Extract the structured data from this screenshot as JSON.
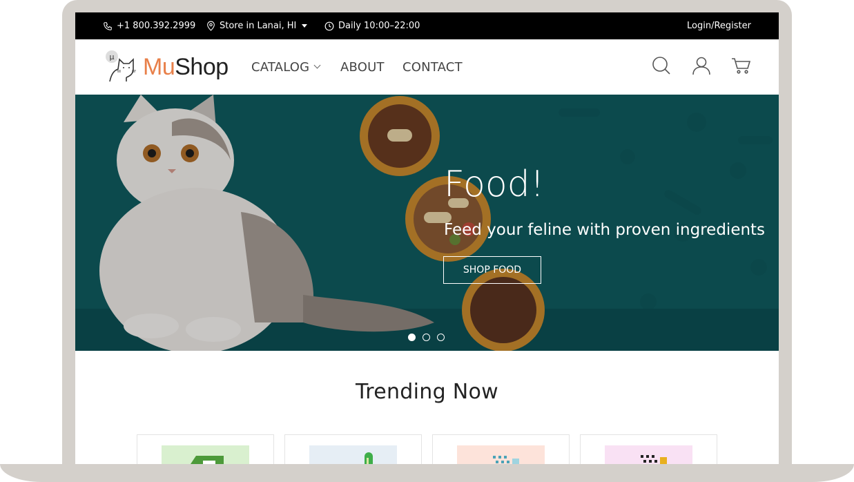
{
  "topbar": {
    "phone": "+1 800.392.2999",
    "store": "Store in Lanai, HI",
    "hours": "Daily 10:00–22:00",
    "login": "Login/Register"
  },
  "nav": {
    "logo_mu": "Mu",
    "logo_shop": "Shop",
    "logo_badge": "µ",
    "menu": [
      {
        "label": "CATALOG"
      },
      {
        "label": "ABOUT"
      },
      {
        "label": "CONTACT"
      }
    ],
    "icons": [
      "search-icon",
      "user-icon",
      "cart-icon"
    ]
  },
  "hero": {
    "title": "Food!",
    "subtitle": "Feed your feline with proven ingredients",
    "cta": "SHOP FOOD",
    "slides": 3,
    "active_slide": 1
  },
  "trending": {
    "heading": "Trending Now",
    "cards": [
      {
        "thumb_color": "#d9f0cf"
      },
      {
        "thumb_color": "#e6eef5"
      },
      {
        "thumb_color": "#fde3da"
      },
      {
        "thumb_color": "#f9e1f4"
      }
    ]
  },
  "colors": {
    "accent": "#e8804a",
    "hero_bg": "#0f5b5f",
    "topbar_bg": "#000000"
  }
}
